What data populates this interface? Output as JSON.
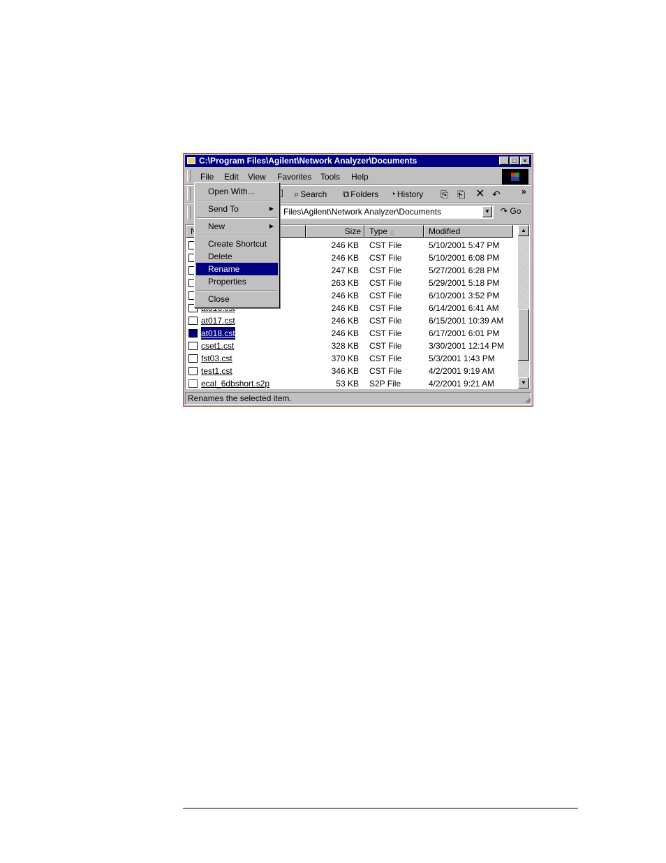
{
  "window": {
    "title": "C:\\Program Files\\Agilent\\Network Analyzer\\Documents",
    "minimize": "_",
    "maximize": "□",
    "close": "×"
  },
  "menubar": [
    "File",
    "Edit",
    "View",
    "Favorites",
    "Tools",
    "Help"
  ],
  "toolbar": {
    "search": "Search",
    "folders": "Folders",
    "history": "History",
    "more": "»"
  },
  "address": {
    "value": "Files\\Agilent\\Network Analyzer\\Documents",
    "go": "Go"
  },
  "columns": {
    "name": "N",
    "size": "Size",
    "type": "Type",
    "modified": "Modified"
  },
  "files": [
    {
      "name": "",
      "size": "246 KB",
      "type": "CST File",
      "modified": "5/10/2001 5:47 PM"
    },
    {
      "name": "",
      "size": "246 KB",
      "type": "CST File",
      "modified": "5/10/2001 6:08 PM"
    },
    {
      "name": "",
      "size": "247 KB",
      "type": "CST File",
      "modified": "5/27/2001 6:28 PM"
    },
    {
      "name": "",
      "size": "263 KB",
      "type": "CST File",
      "modified": "5/29/2001 5:18 PM"
    },
    {
      "name": "",
      "size": "246 KB",
      "type": "CST File",
      "modified": "6/10/2001 3:52 PM"
    },
    {
      "name": "at016.cst",
      "size": "246 KB",
      "type": "CST File",
      "modified": "6/14/2001 6:41 AM"
    },
    {
      "name": "at017.cst",
      "size": "246 KB",
      "type": "CST File",
      "modified": "6/15/2001 10:39 AM"
    },
    {
      "name": "at018.cst",
      "size": "246 KB",
      "type": "CST File",
      "modified": "6/17/2001 6:01 PM"
    },
    {
      "name": "cset1.cst",
      "size": "328 KB",
      "type": "CST File",
      "modified": "3/30/2001 12:14 PM"
    },
    {
      "name": "fst03.cst",
      "size": "370 KB",
      "type": "CST File",
      "modified": "5/3/2001 1:43 PM"
    },
    {
      "name": "test1.cst",
      "size": "346 KB",
      "type": "CST File",
      "modified": "4/2/2001 9:19 AM"
    },
    {
      "name": "ecal_6dbshort.s2p",
      "size": "53 KB",
      "type": "S2P File",
      "modified": "4/2/2001 9:21 AM"
    }
  ],
  "file_menu": {
    "open_with": "Open With...",
    "send_to": "Send To",
    "new": "New",
    "create_shortcut": "Create Shortcut",
    "delete": "Delete",
    "rename": "Rename",
    "properties": "Properties",
    "close": "Close"
  },
  "status": "Renames the selected item."
}
